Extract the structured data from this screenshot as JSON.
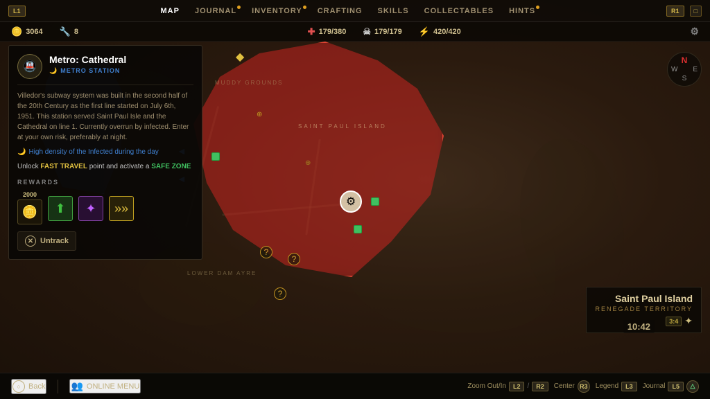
{
  "nav": {
    "left_btn": "L1",
    "right_btn": "R1",
    "right_sq_btn": "□",
    "tabs": [
      {
        "id": "map",
        "label": "MAP",
        "active": true,
        "dot": false
      },
      {
        "id": "journal",
        "label": "JOURNAL",
        "active": false,
        "dot": true
      },
      {
        "id": "inventory",
        "label": "INVENTORY",
        "active": false,
        "dot": true
      },
      {
        "id": "crafting",
        "label": "CRAFTING",
        "active": false,
        "dot": false
      },
      {
        "id": "skills",
        "label": "SKILLS",
        "active": false,
        "dot": false
      },
      {
        "id": "collectables",
        "label": "COLLECTABLES",
        "active": false,
        "dot": false
      },
      {
        "id": "hints",
        "label": "HINTS",
        "active": false,
        "dot": true
      }
    ]
  },
  "stats": {
    "coins": "3064",
    "coins_icon": "🪙",
    "wrench_icon": "🔧",
    "wrench_val": "8",
    "health_icon": "✚",
    "health_current": "179",
    "health_max": "380",
    "skull_icon": "☠",
    "kills_current": "179",
    "kills_max": "179",
    "bolt_icon": "⚡",
    "stamina_current": "420",
    "stamina_max": "420"
  },
  "info_panel": {
    "icon": "🚇",
    "title": "Metro: Cathedral",
    "subtitle": "METRO STATION",
    "subtitle_icon": "🌙",
    "description": "Villedor's subway system was built in the second half of the 20th Century as the first line started on July 6th, 1951. This station served Saint Paul Isle and the Cathedral on line 1. Currently overrun by infected. Enter at your own risk, preferably at night.",
    "warning": "High density of the Infected during the day",
    "unlock_text_1": "Unlock ",
    "fast_travel": "FAST TRAVEL",
    "unlock_text_2": " point and activate a ",
    "safe_zone": "SAFE ZONE",
    "rewards_title": "REWARDS",
    "reward_amount": "2000",
    "untrack_label": "Untrack"
  },
  "location": {
    "name": "Saint Paul Island",
    "subtitle": "RENEGADE TERRITORY",
    "badge": "3:4"
  },
  "time": "10:42",
  "compass": {
    "n": "N",
    "s": "S",
    "e": "E",
    "w": "W"
  },
  "bottom": {
    "back_label": "Back",
    "back_btn": "○",
    "online_icon": "👥",
    "online_label": "ONLINE MENU",
    "zoom_label": "Zoom Out/In",
    "zoom_btn1": "L2",
    "zoom_btn2": "R2",
    "center_label": "Center",
    "center_btn": "R3",
    "legend_label": "Legend",
    "legend_btn": "L3",
    "journal_label": "Journal",
    "journal_btn": "L5",
    "triangle_btn": "△"
  },
  "map": {
    "zone_label": "SAINT PAUL ISLAND",
    "area_left": "LOWER DAM AYRE",
    "area_top": "MUDDY GROUNDS"
  }
}
